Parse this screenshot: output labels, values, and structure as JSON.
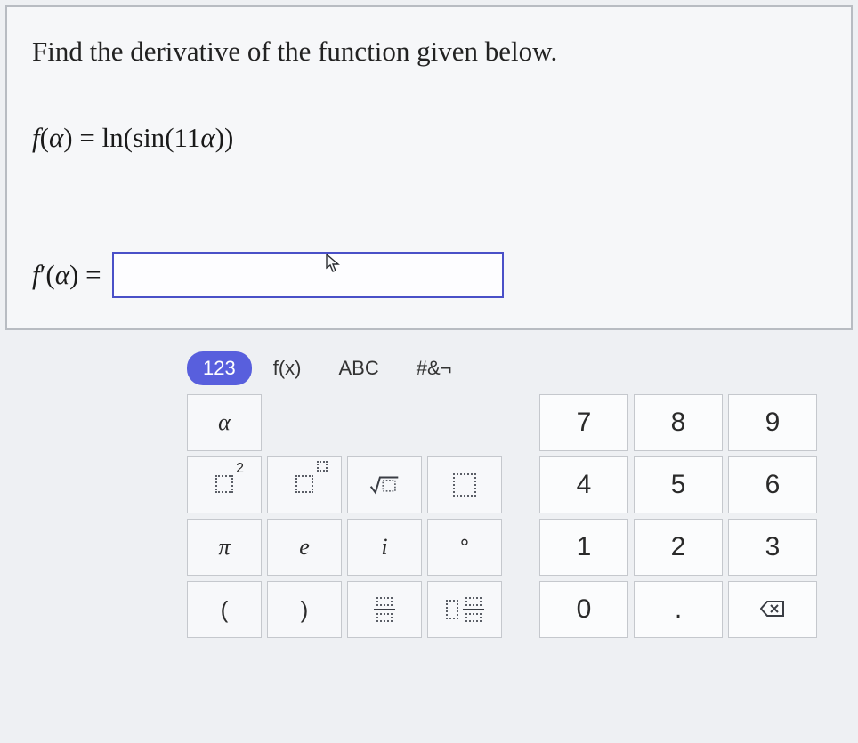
{
  "problem": {
    "prompt": "Find the derivative of the function given below.",
    "function_html": "f(α) = ln(sin(11α))",
    "deriv_label": "f′(α) =",
    "answer_value": ""
  },
  "keypad": {
    "tabs": {
      "numbers": "123",
      "functions": "f(x)",
      "letters": "ABC",
      "symbols": "#&¬"
    },
    "active_tab": "numbers",
    "sym": {
      "alpha": "α",
      "sq_exp": "2",
      "pi": "π",
      "e": "e",
      "i": "i",
      "deg": "°",
      "lparen": "(",
      "rparen": ")"
    },
    "num": {
      "7": "7",
      "8": "8",
      "9": "9",
      "4": "4",
      "5": "5",
      "6": "6",
      "1": "1",
      "2": "2",
      "3": "3",
      "0": "0",
      "dot": "."
    }
  }
}
